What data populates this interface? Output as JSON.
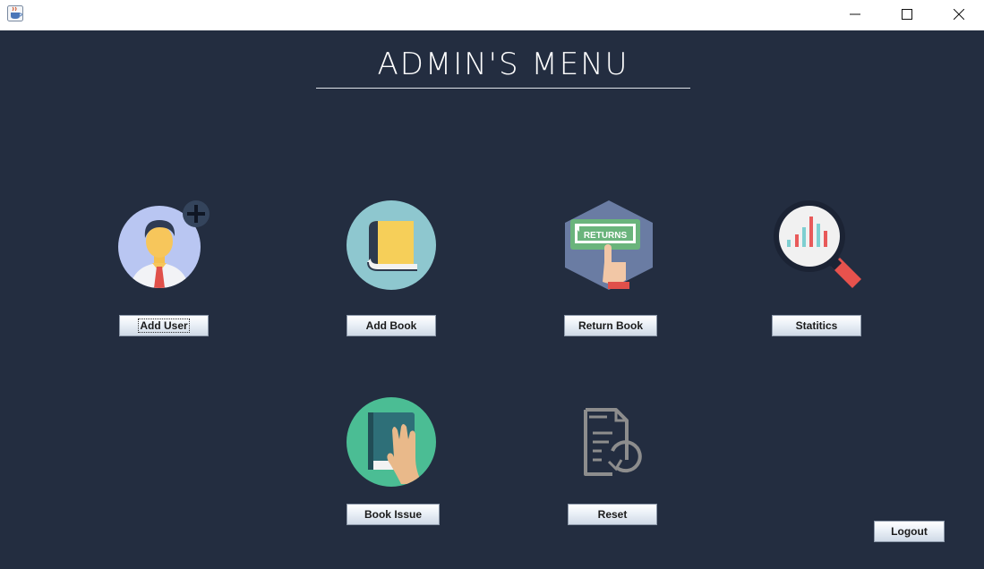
{
  "window": {
    "title": "",
    "controls": [
      "minimize",
      "maximize",
      "close"
    ]
  },
  "menu": {
    "title": "ADMIN'S MENU"
  },
  "buttons": {
    "add_user": "Add User",
    "add_book": "Add Book",
    "return_book": "Return Book",
    "statistics": "Statitics",
    "book_issue": "Book Issue",
    "reset": "Reset",
    "logout": "Logout"
  },
  "icons": {
    "add_user": "add-user-icon",
    "add_book": "book-icon",
    "return_book": "returns-sign-icon",
    "statistics": "magnifier-chart-icon",
    "book_issue": "hand-on-book-icon",
    "reset": "document-reset-icon",
    "returns_sign_text": "RETURNS"
  },
  "colors": {
    "background": "#232d40",
    "button_text": "#1b1b1b"
  }
}
